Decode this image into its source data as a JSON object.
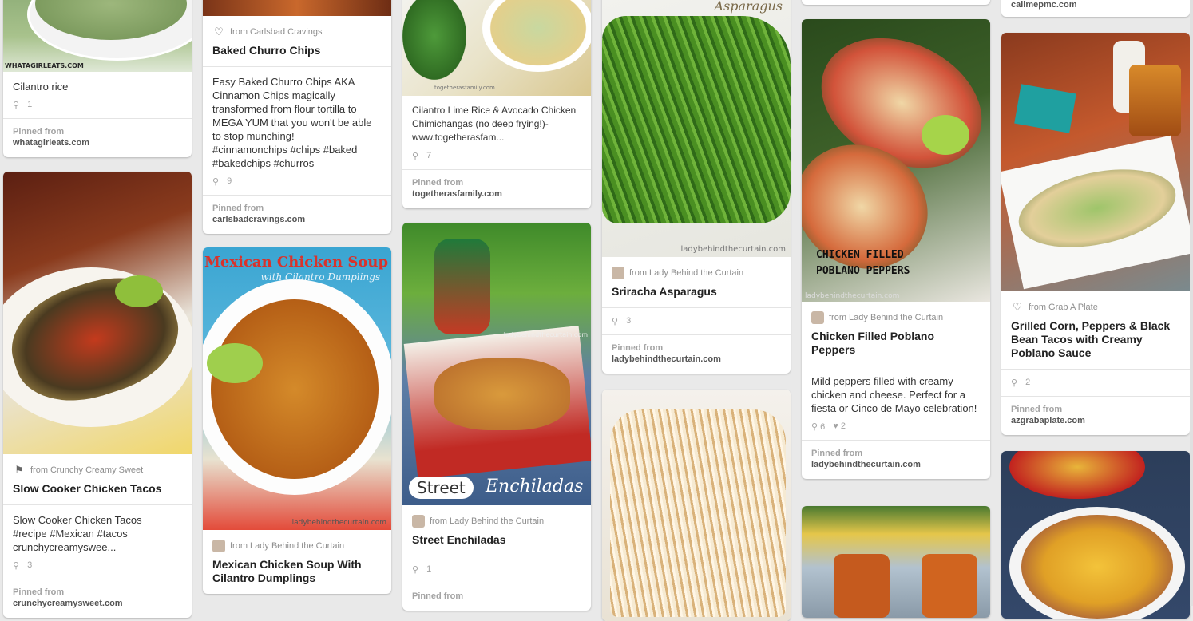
{
  "pinned_from_label": "Pinned from",
  "columns": [
    [
      {
        "image_caption": "WHATAGIRLEATS.COM",
        "desc": "Cilantro rice",
        "repins": "1",
        "domain": "whatagirleats.com"
      },
      {
        "source": "from Crunchy Creamy Sweet",
        "title": "Slow Cooker Chicken Tacos",
        "desc": "Slow Cooker Chicken Tacos",
        "tags": "#recipe #Mexican #tacos crunchycreamyswee...",
        "repins": "3",
        "domain": "crunchycreamysweet.com"
      }
    ],
    [
      {
        "source": "from Carlsbad Cravings",
        "title": "Baked Churro Chips",
        "desc": "Easy Baked Churro Chips AKA Cinnamon Chips magically transformed from flour tortilla to MEGA YUM that you won't be able to stop munching!",
        "tags": "#cinnamonchips #chips #baked #bakedchips #churros",
        "repins": "9",
        "domain": "carlsbadcravings.com"
      },
      {
        "image_title": "Mexican Chicken Soup",
        "image_subtitle": "with Cilantro Dumplings",
        "image_watermark": "ladybehindthecurtain.com",
        "source": "from Lady Behind the Curtain",
        "title": "Mexican Chicken Soup With Cilantro Dumplings"
      }
    ],
    [
      {
        "image_watermark": "togetherasfamily.com",
        "desc": "Cilantro Lime Rice & Avocado Chicken Chimichangas (no deep frying!)- www.togetherasfam...",
        "repins": "7",
        "domain": "togetherasfamily.com"
      },
      {
        "image_watermark": "ladybehindthecurtain.com",
        "image_label_1": "Street",
        "image_label_2": "Enchiladas",
        "source": "from Lady Behind the Curtain",
        "title": "Street Enchiladas",
        "repins": "1"
      }
    ],
    [
      {
        "image_title": "Asparagus",
        "image_watermark": "ladybehindthecurtain.com",
        "source": "from Lady Behind the Curtain",
        "title": "Sriracha Asparagus",
        "repins": "3",
        "domain": "ladybehindthecurtain.com"
      },
      {}
    ],
    [
      {
        "image_title": "CHICKEN FILLED POBLANO PEPPERS",
        "image_watermark": "ladybehindthecurtain.com",
        "source": "from Lady Behind the Curtain",
        "title": "Chicken Filled Poblano Peppers",
        "desc": "Mild peppers filled with creamy chicken and cheese. Perfect for a fiesta or Cinco de Mayo celebration!",
        "repins": "6",
        "likes": "2",
        "domain": "ladybehindthecurtain.com"
      },
      {}
    ],
    [
      {
        "domain": "callmepmc.com"
      },
      {
        "source": "from Grab A Plate",
        "title": "Grilled Corn, Peppers & Black Bean Tacos with Creamy Poblano Sauce",
        "repins": "2",
        "domain": "azgrabaplate.com"
      },
      {}
    ]
  ]
}
